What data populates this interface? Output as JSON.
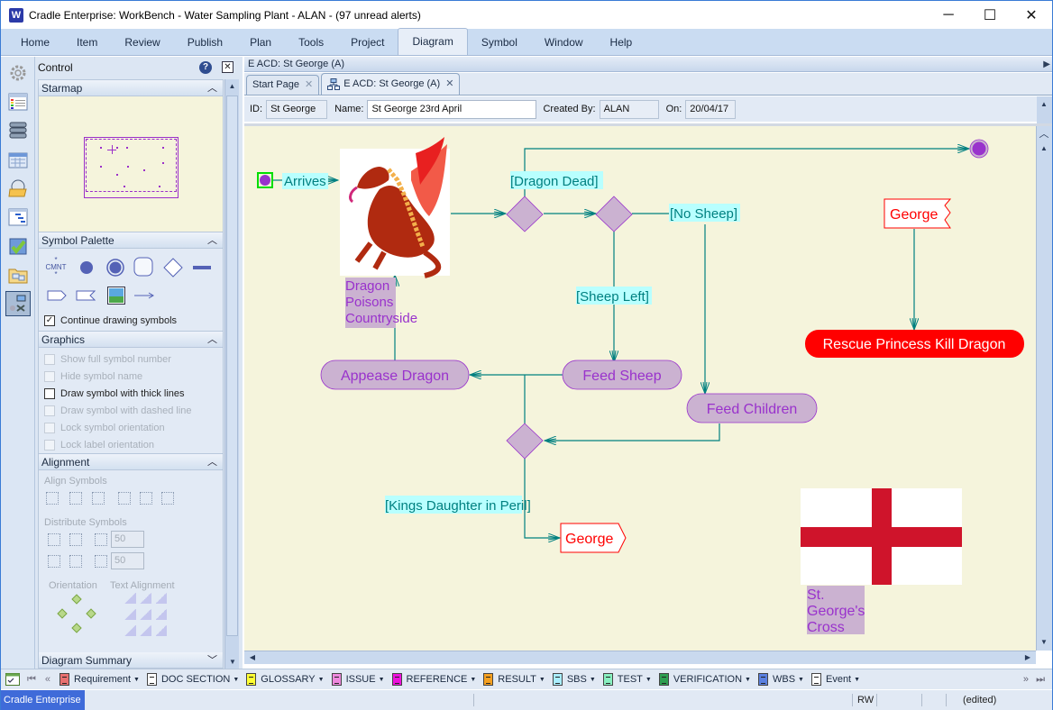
{
  "window": {
    "title": "Cradle Enterprise: WorkBench - Water Sampling Plant - ALAN - (97 unread alerts)",
    "app_icon_letter": "W",
    "minimize": "─",
    "maximize": "☐",
    "close": "✕"
  },
  "menu": [
    {
      "label": "Home"
    },
    {
      "label": "Item"
    },
    {
      "label": "Review"
    },
    {
      "label": "Publish"
    },
    {
      "label": "Plan"
    },
    {
      "label": "Tools"
    },
    {
      "label": "Project"
    },
    {
      "label": "Diagram",
      "active": true
    },
    {
      "label": "Symbol"
    },
    {
      "label": "Window"
    },
    {
      "label": "Help"
    }
  ],
  "sidebar_icons": [
    "gear-icon",
    "item-list-icon",
    "database-icon",
    "calendar-icon",
    "folder-open-icon",
    "gantt-icon",
    "checklist-icon",
    "folder-view-icon",
    "diagram-tools-icon"
  ],
  "control": {
    "title": "Control",
    "help_glyph": "?",
    "close_glyph": "✕",
    "sections": {
      "starmap": "Starmap",
      "palette": "Symbol Palette",
      "graphics": "Graphics",
      "alignment": "Alignment",
      "summary": "Diagram Summary"
    },
    "palette_comment_label": "CMNT",
    "continue_drawing": {
      "label": "Continue drawing symbols",
      "checked": true
    },
    "graphics_options": [
      {
        "label": "Show full symbol number",
        "checked": false,
        "enabled": false
      },
      {
        "label": "Hide symbol name",
        "checked": false,
        "enabled": false
      },
      {
        "label": "Draw symbol with thick lines",
        "checked": false,
        "enabled": true
      },
      {
        "label": "Draw symbol with dashed line",
        "checked": false,
        "enabled": false
      },
      {
        "label": "Lock symbol orientation",
        "checked": false,
        "enabled": false
      },
      {
        "label": "Lock label orientation",
        "checked": false,
        "enabled": false
      }
    ],
    "alignment": {
      "align_symbols": "Align Symbols",
      "distribute_symbols": "Distribute Symbols",
      "h_spacing": "50",
      "v_spacing": "50",
      "orientation": "Orientation",
      "text_alignment": "Text Alignment"
    }
  },
  "document": {
    "header": "E ACD: St George (A)",
    "tabs": [
      {
        "label": "Start Page",
        "active": false
      },
      {
        "label": "E ACD: St George (A)",
        "active": true
      }
    ],
    "tab_close": "✕",
    "fields": {
      "id_label": "ID:",
      "id_value": "St George",
      "name_label": "Name:",
      "name_value": "St George 23rd April",
      "created_by_label": "Created By:",
      "created_by_value": "ALAN",
      "on_label": "On:",
      "on_value": "20/04/17"
    }
  },
  "diagram": {
    "colors": {
      "canvas": "#f5f4dc",
      "line": "#008080",
      "node_fill": "#cbb2d1",
      "node_text": "#9932cc",
      "guard_fill": "#b8ffff",
      "signal_red": "#ff0000",
      "flag_red": "#cf142b"
    },
    "guards": {
      "arrives": "Arrives",
      "dragon_dead": "[Dragon Dead]",
      "no_sheep": "[No Sheep]",
      "sheep_left": "[Sheep Left]",
      "kings_daughter": "[Kings Daughter in Peril]"
    },
    "dragon_label": [
      "Dragon",
      "Poisons",
      "Countryside"
    ],
    "actions": {
      "appease": "Appease Dragon",
      "feed_sheep": "Feed Sheep",
      "feed_children": "Feed Children",
      "rescue": "Rescue Princess Kill Dragon"
    },
    "signals": {
      "send_george": "George",
      "receive_george": "George"
    },
    "flag_label": [
      "St.",
      "George's",
      "Cross"
    ]
  },
  "bottom_toolbar": {
    "items": [
      {
        "label": "Requirement",
        "color": "#e87070"
      },
      {
        "label": "DOC SECTION",
        "color": "#ffffff"
      },
      {
        "label": "GLOSSARY",
        "color": "#ffff33"
      },
      {
        "label": "ISSUE",
        "color": "#ee88dd"
      },
      {
        "label": "REFERENCE",
        "color": "#ee11dd"
      },
      {
        "label": "RESULT",
        "color": "#f5a020"
      },
      {
        "label": "SBS",
        "color": "#aaeeff"
      },
      {
        "label": "TEST",
        "color": "#88f0c0"
      },
      {
        "label": "VERIFICATION",
        "color": "#2e9e50"
      },
      {
        "label": "WBS",
        "color": "#5a80e0"
      },
      {
        "label": "Event",
        "color": "#ffffff"
      }
    ]
  },
  "status": {
    "app": "Cradle Enterprise",
    "mode": "RW",
    "state": "(edited)"
  }
}
